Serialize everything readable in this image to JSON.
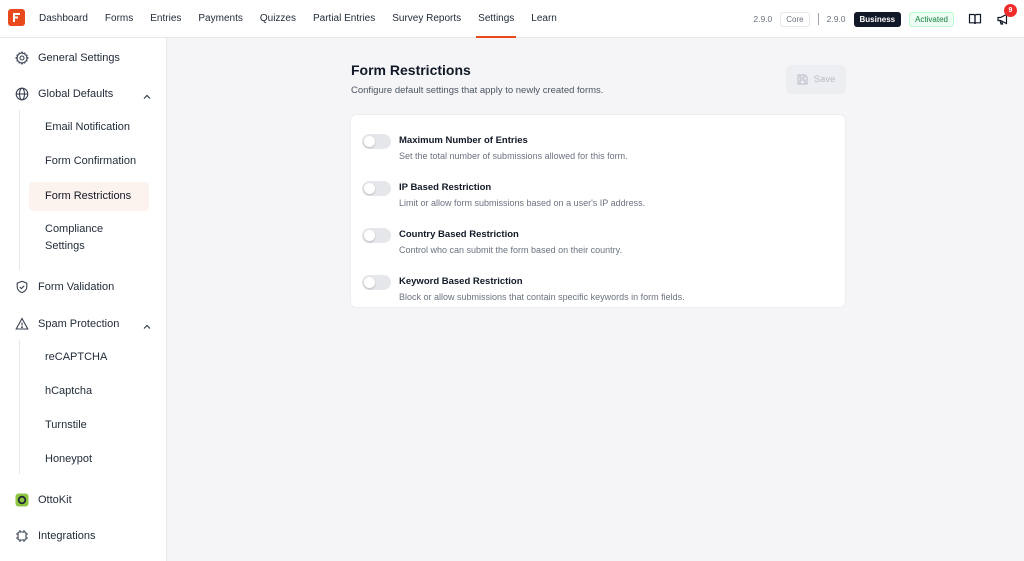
{
  "topbar": {
    "nav": [
      {
        "label": "Dashboard",
        "active": false
      },
      {
        "label": "Forms",
        "active": false
      },
      {
        "label": "Entries",
        "active": false
      },
      {
        "label": "Payments",
        "active": false
      },
      {
        "label": "Quizzes",
        "active": false
      },
      {
        "label": "Partial Entries",
        "active": false
      },
      {
        "label": "Survey Reports",
        "active": false
      },
      {
        "label": "Settings",
        "active": true
      },
      {
        "label": "Learn",
        "active": false
      }
    ],
    "core_version": "2.9.0",
    "core_label": "Core",
    "business_version": "2.9.0",
    "business_label": "Business",
    "activated_label": "Activated",
    "notification_count": "9",
    "accent_color": "#e8491d"
  },
  "sidebar": {
    "general_settings": "General Settings",
    "global_defaults": "Global Defaults",
    "global_sub": {
      "email_notification": "Email Notification",
      "form_confirmation": "Form Confirmation",
      "form_restrictions": "Form Restrictions",
      "compliance_line1": "Compliance",
      "compliance_line2": "Settings"
    },
    "form_validation": "Form Validation",
    "spam_protection": "Spam Protection",
    "spam_sub": {
      "recaptcha": "reCAPTCHA",
      "hcaptcha": "hCaptcha",
      "turnstile": "Turnstile",
      "honeypot": "Honeypot"
    },
    "ottokit": "OttoKit",
    "integrations": "Integrations"
  },
  "main": {
    "title": "Form Restrictions",
    "subtitle": "Configure default settings that apply to newly created forms.",
    "save_label": "Save",
    "restrictions": [
      {
        "title": "Maximum Number of Entries",
        "description": "Set the total number of submissions allowed for this form.",
        "enabled": false
      },
      {
        "title": "IP Based Restriction",
        "description": "Limit or allow form submissions based on a user's IP address.",
        "enabled": false
      },
      {
        "title": "Country Based Restriction",
        "description": "Control who can submit the form based on their country.",
        "enabled": false
      },
      {
        "title": "Keyword Based Restriction",
        "description": "Block or allow submissions that contain specific keywords in form fields.",
        "enabled": false
      }
    ]
  }
}
